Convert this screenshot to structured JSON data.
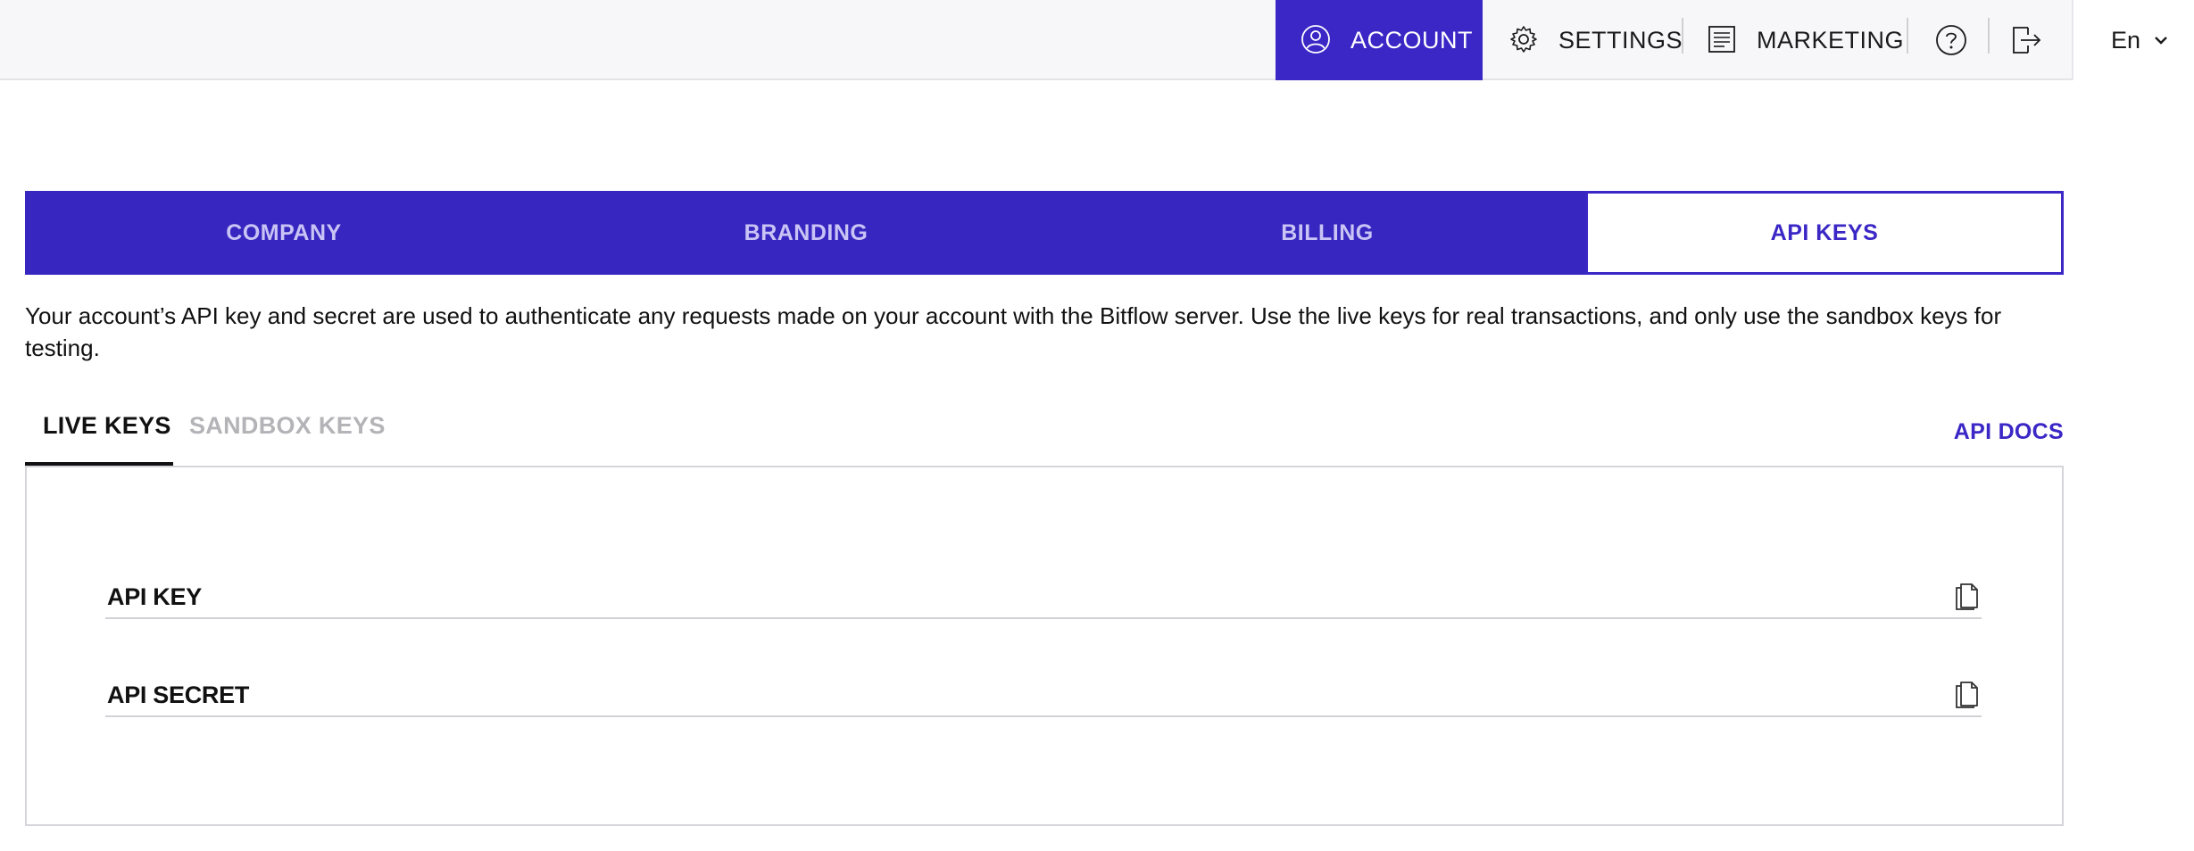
{
  "nav": {
    "account": "ACCOUNT",
    "settings": "SETTINGS",
    "marketing": "MARKETING",
    "language": "En"
  },
  "section_tabs": [
    "COMPANY",
    "BRANDING",
    "BILLING",
    "API KEYS"
  ],
  "active_section_tab": "API KEYS",
  "description": "Your account’s API key and secret are used to authenticate any requests made on your account with the Bitflow server. Use the live keys for real transactions, and only use the sandbox keys for testing.",
  "key_tabs": {
    "live": "LIVE KEYS",
    "sandbox": "SANDBOX KEYS",
    "active": "LIVE KEYS"
  },
  "api_docs": "API DOCS",
  "keys": {
    "api_key_label": "API KEY",
    "api_secret_label": "API SECRET"
  },
  "icons": [
    "user-icon",
    "gear-icon",
    "document-icon",
    "help-icon",
    "logout-icon",
    "chevron-down-icon",
    "copy-icon"
  ],
  "colors": {
    "accent": "#3a27c6",
    "tab_inactive_text": "#c9c4f5",
    "muted_tab": "#b4b4b8",
    "topbar_bg": "#f7f7f9"
  }
}
